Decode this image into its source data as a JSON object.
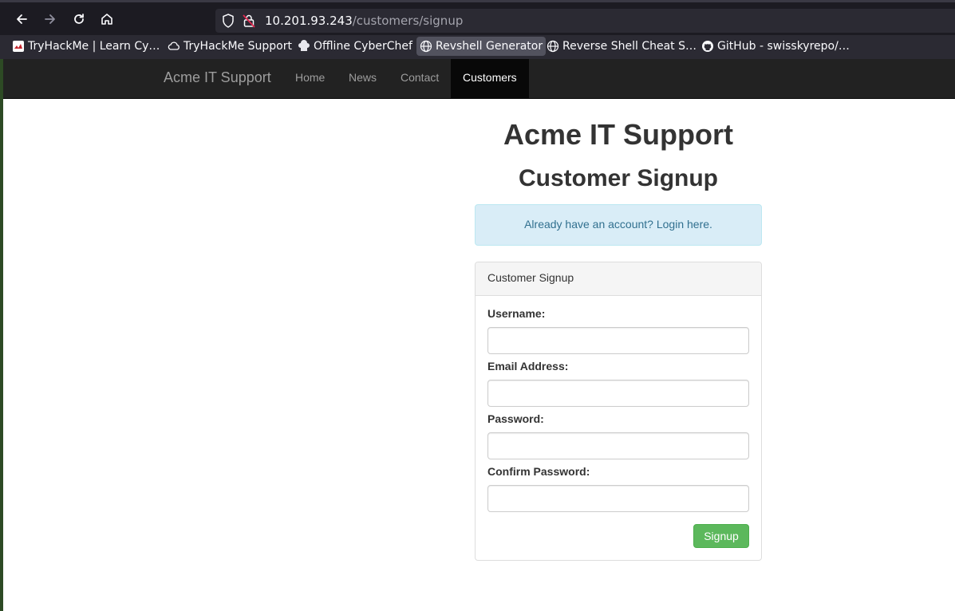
{
  "browser": {
    "url_host": "10.201.93.243",
    "url_path": "/customers/signup",
    "bookmarks": [
      {
        "label": "TryHackMe | Learn Cy…",
        "icon": "tryhackme-icon"
      },
      {
        "label": "TryHackMe Support",
        "icon": "cloud-icon"
      },
      {
        "label": "Offline CyberChef",
        "icon": "chef-hat-icon"
      },
      {
        "label": "Revshell Generator",
        "icon": "globe-icon"
      },
      {
        "label": "Reverse Shell Cheat S…",
        "icon": "globe-icon"
      },
      {
        "label": "GitHub - swisskyrepo/…",
        "icon": "github-icon"
      }
    ]
  },
  "navbar": {
    "brand": "Acme IT Support",
    "links": [
      "Home",
      "News",
      "Contact",
      "Customers"
    ],
    "active": "Customers"
  },
  "main": {
    "site_title": "Acme IT Support",
    "page_title": "Customer Signup",
    "alert_text": "Already have an account? Login here."
  },
  "form": {
    "panel_title": "Customer Signup",
    "fields": [
      {
        "label": "Username:",
        "value": ""
      },
      {
        "label": "Email Address:",
        "value": ""
      },
      {
        "label": "Password:",
        "value": ""
      },
      {
        "label": "Confirm Password:",
        "value": ""
      }
    ],
    "submit_label": "Signup"
  },
  "colors": {
    "navbar_bg": "#222222",
    "alert_bg": "#d9edf7",
    "alert_text": "#31708f",
    "button_success": "#5cb85c"
  }
}
